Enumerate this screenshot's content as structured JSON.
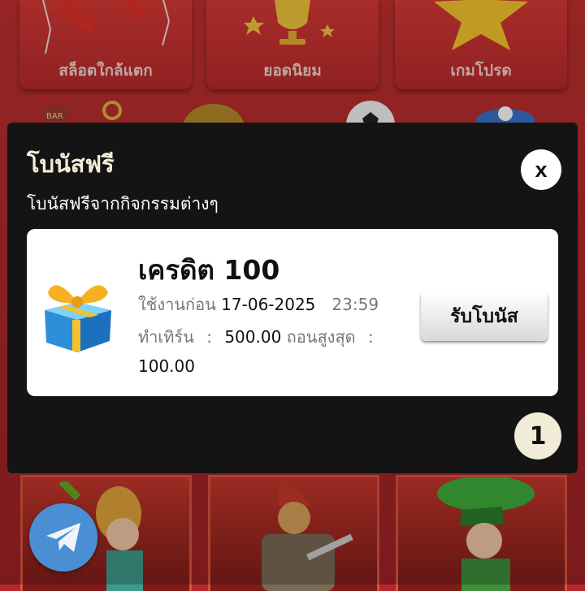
{
  "categories": [
    {
      "label": "สล็อตใกล้แตก",
      "icon": "rocket-icon"
    },
    {
      "label": "ยอดนิยม",
      "icon": "trophy-icon"
    },
    {
      "label": "เกมโปรด",
      "icon": "star-icon"
    }
  ],
  "modal": {
    "title": "โบนัสฟรี",
    "subtitle": "โบนัสฟรีจากกิจกรรมต่างๆ",
    "close_label": "x",
    "page_number": "1"
  },
  "bonus": {
    "title": "เครดิต 100",
    "expire_label": "ใช้งานก่อน",
    "expire_date": "17-06-2025",
    "expire_time": "23:59",
    "turnover_label": "ทำเทิร์น",
    "turnover_separator": ":",
    "turnover_value": "500.00",
    "max_withdraw_label": "ถอนสูงสุด",
    "max_withdraw_separator": ":",
    "max_withdraw_value": "100.00",
    "claim_label": "รับโบนัส",
    "icon": "gift-box-icon"
  },
  "floating": {
    "telegram_icon": "telegram-icon"
  },
  "colors": {
    "accent_red": "#c0302f",
    "modal_bg": "#141414",
    "badge_bg": "#f1ecd7",
    "telegram_blue": "#4a8fd4"
  }
}
